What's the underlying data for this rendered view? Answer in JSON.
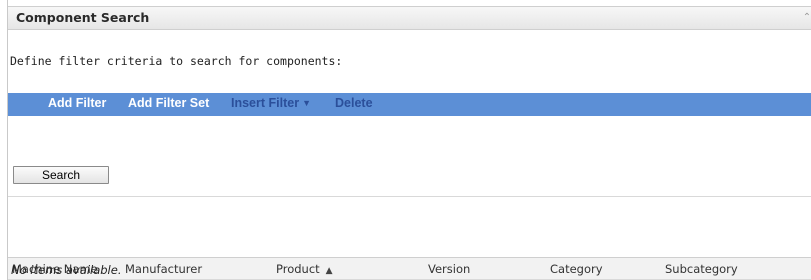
{
  "panel": {
    "title": "Component Search",
    "collapse_icon": "collapse-up-icon"
  },
  "intro_text": "Define filter criteria to search for components:",
  "filter_toolbar": {
    "add_filter": "Add Filter",
    "add_filter_set": "Add Filter Set",
    "insert_filter": "Insert Filter",
    "delete": "Delete"
  },
  "search_button": "Search",
  "results_table": {
    "columns": [
      "Machine Name",
      "Manufacturer",
      "Product",
      "Version",
      "Category",
      "Subcategory"
    ],
    "sorted_column": "Product",
    "empty_message": "No items available."
  },
  "colors": {
    "toolbar_bg": "#5c8fd6",
    "toolbar_active_text": "#ffffff",
    "toolbar_inactive_text": "#2b4f9a"
  }
}
